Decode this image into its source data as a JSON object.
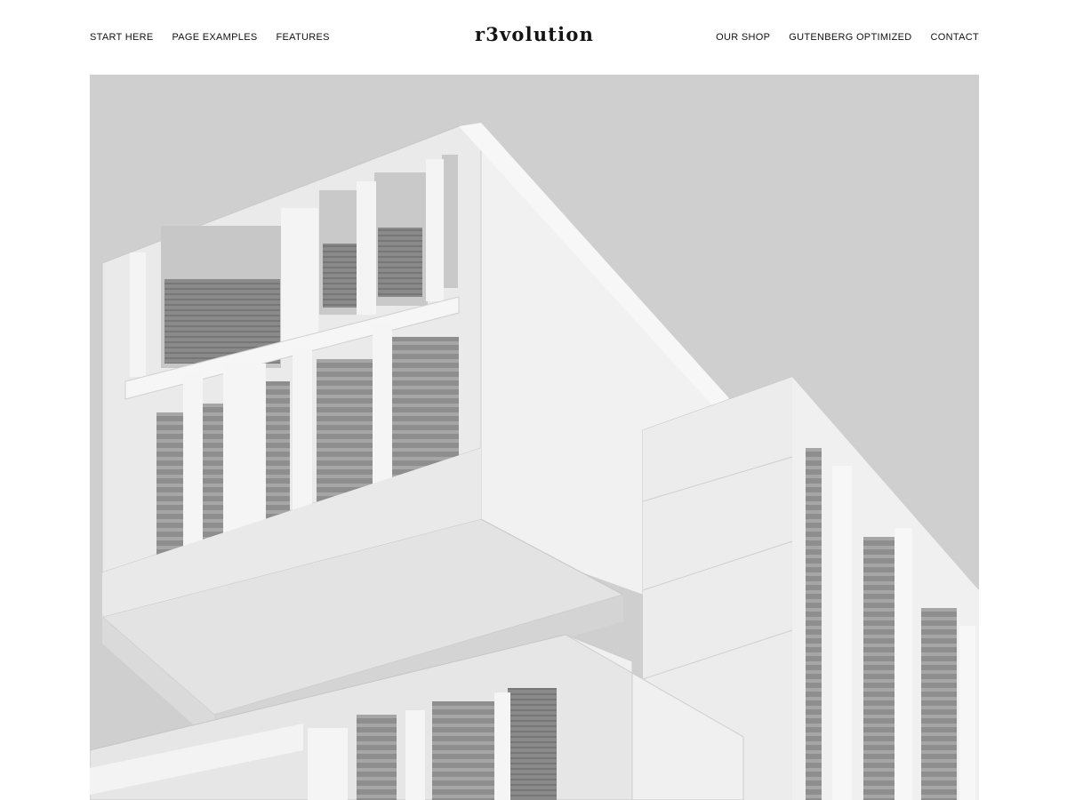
{
  "site": {
    "logo": "r3volution"
  },
  "nav": {
    "left": [
      {
        "label": "START HERE"
      },
      {
        "label": "PAGE EXAMPLES"
      },
      {
        "label": "FEATURES"
      }
    ],
    "right": [
      {
        "label": "OUR SHOP"
      },
      {
        "label": "GUTENBERG OPTIMIZED"
      },
      {
        "label": "CONTACT"
      }
    ]
  },
  "hero": {
    "image_subject": "grayscale-modern-building",
    "colors": {
      "sky": "#cfcfcf",
      "facade": "#ededed",
      "shadow": "#d8d8d8",
      "window": "#9a9a9a"
    }
  }
}
